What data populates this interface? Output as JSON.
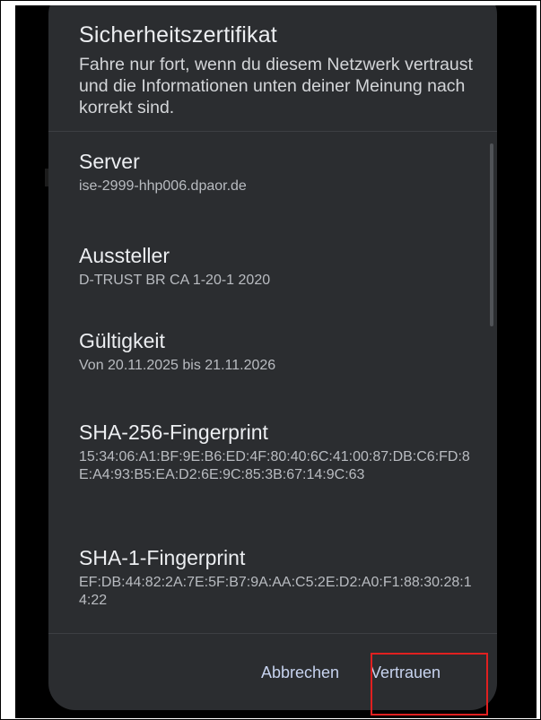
{
  "dialog": {
    "title": "Sicherheitszertifikat",
    "message": "Fahre nur fort, wenn du diesem Netzwerk vertraust und die Informationen unten deiner Meinung nach korrekt sind."
  },
  "fields": {
    "server": {
      "label": "Server",
      "value": "ise-2999-hhp006.dpaor.de"
    },
    "issuer": {
      "label": "Aussteller",
      "value": "D-TRUST BR CA 1-20-1 2020"
    },
    "validity": {
      "label": "Gültigkeit",
      "value": "Von 20.11.2025 bis 21.11.2026"
    },
    "sha256": {
      "label": "SHA-256-Fingerprint",
      "value": "15:34:06:A1:BF:9E:B6:ED:4F:80:40:6C:41:00:87:DB:C6:FD:8E:A4:93:B5:EA:D2:6E:9C:85:3B:67:14:9C:63"
    },
    "sha1": {
      "label": "SHA-1-Fingerprint",
      "value": "EF:DB:44:82:2A:7E:5F:B7:9A:AA:C5:2E:D2:A0:F1:88:30:28:14:22"
    }
  },
  "actions": {
    "cancel_label": "Abbrechen",
    "trust_label": "Vertrauen"
  },
  "colors": {
    "dialog_bg": "#2b2d30",
    "button_text": "#c7d3ef",
    "highlight": "#e02020"
  }
}
